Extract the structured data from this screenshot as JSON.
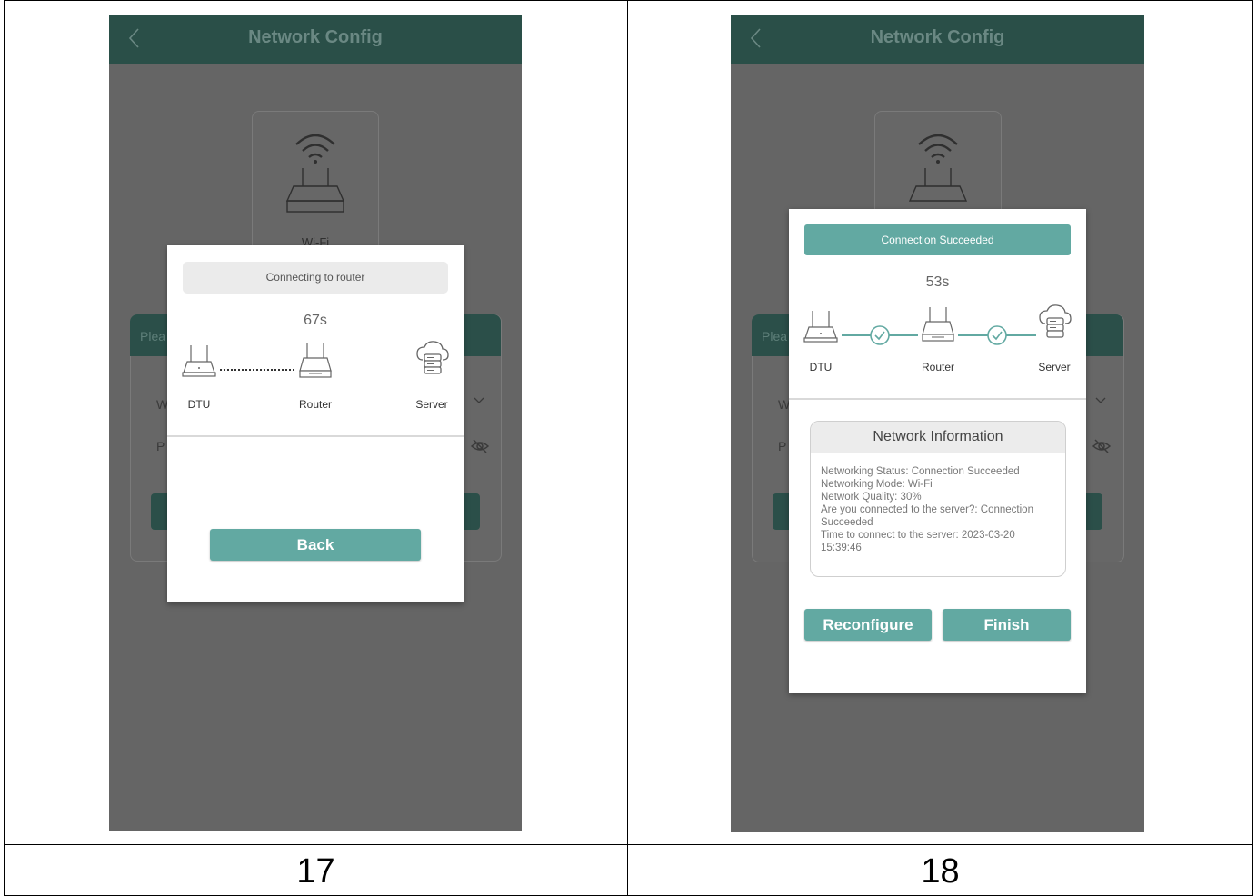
{
  "panels": [
    {
      "caption": "17",
      "app_bar": {
        "title": "Network Config"
      },
      "background": {
        "tile_label": "Wi-Fi",
        "card_header_fragment": "Plea",
        "row_w_fragment": "W",
        "row_p_fragment": "P"
      },
      "dialog": {
        "status": "Connecting to router",
        "timer": "67s",
        "devices": [
          "DTU",
          "Router",
          "Server"
        ],
        "back_button": "Back"
      }
    },
    {
      "caption": "18",
      "app_bar": {
        "title": "Network Config"
      },
      "background": {
        "card_header_fragment": "Plea",
        "row_w_fragment": "W",
        "row_p_fragment": "P"
      },
      "dialog": {
        "status": "Connection Succeeded",
        "timer": "53s",
        "devices": [
          "DTU",
          "Router",
          "Server"
        ],
        "info_title": "Network Information",
        "info_lines": [
          "Networking Status: Connection Succeeded",
          "Networking Mode: Wi-Fi",
          "Network Quality: 30%",
          "Are you connected to the server?: Connection",
          "Succeeded",
          "Time to connect to the server: 2023-03-20",
          "15:39:46"
        ],
        "reconfigure_button": "Reconfigure",
        "finish_button": "Finish"
      }
    }
  ],
  "colors": {
    "app_bar": "#2a4f48",
    "accent": "#62a9a2",
    "overlay": "#656565"
  }
}
